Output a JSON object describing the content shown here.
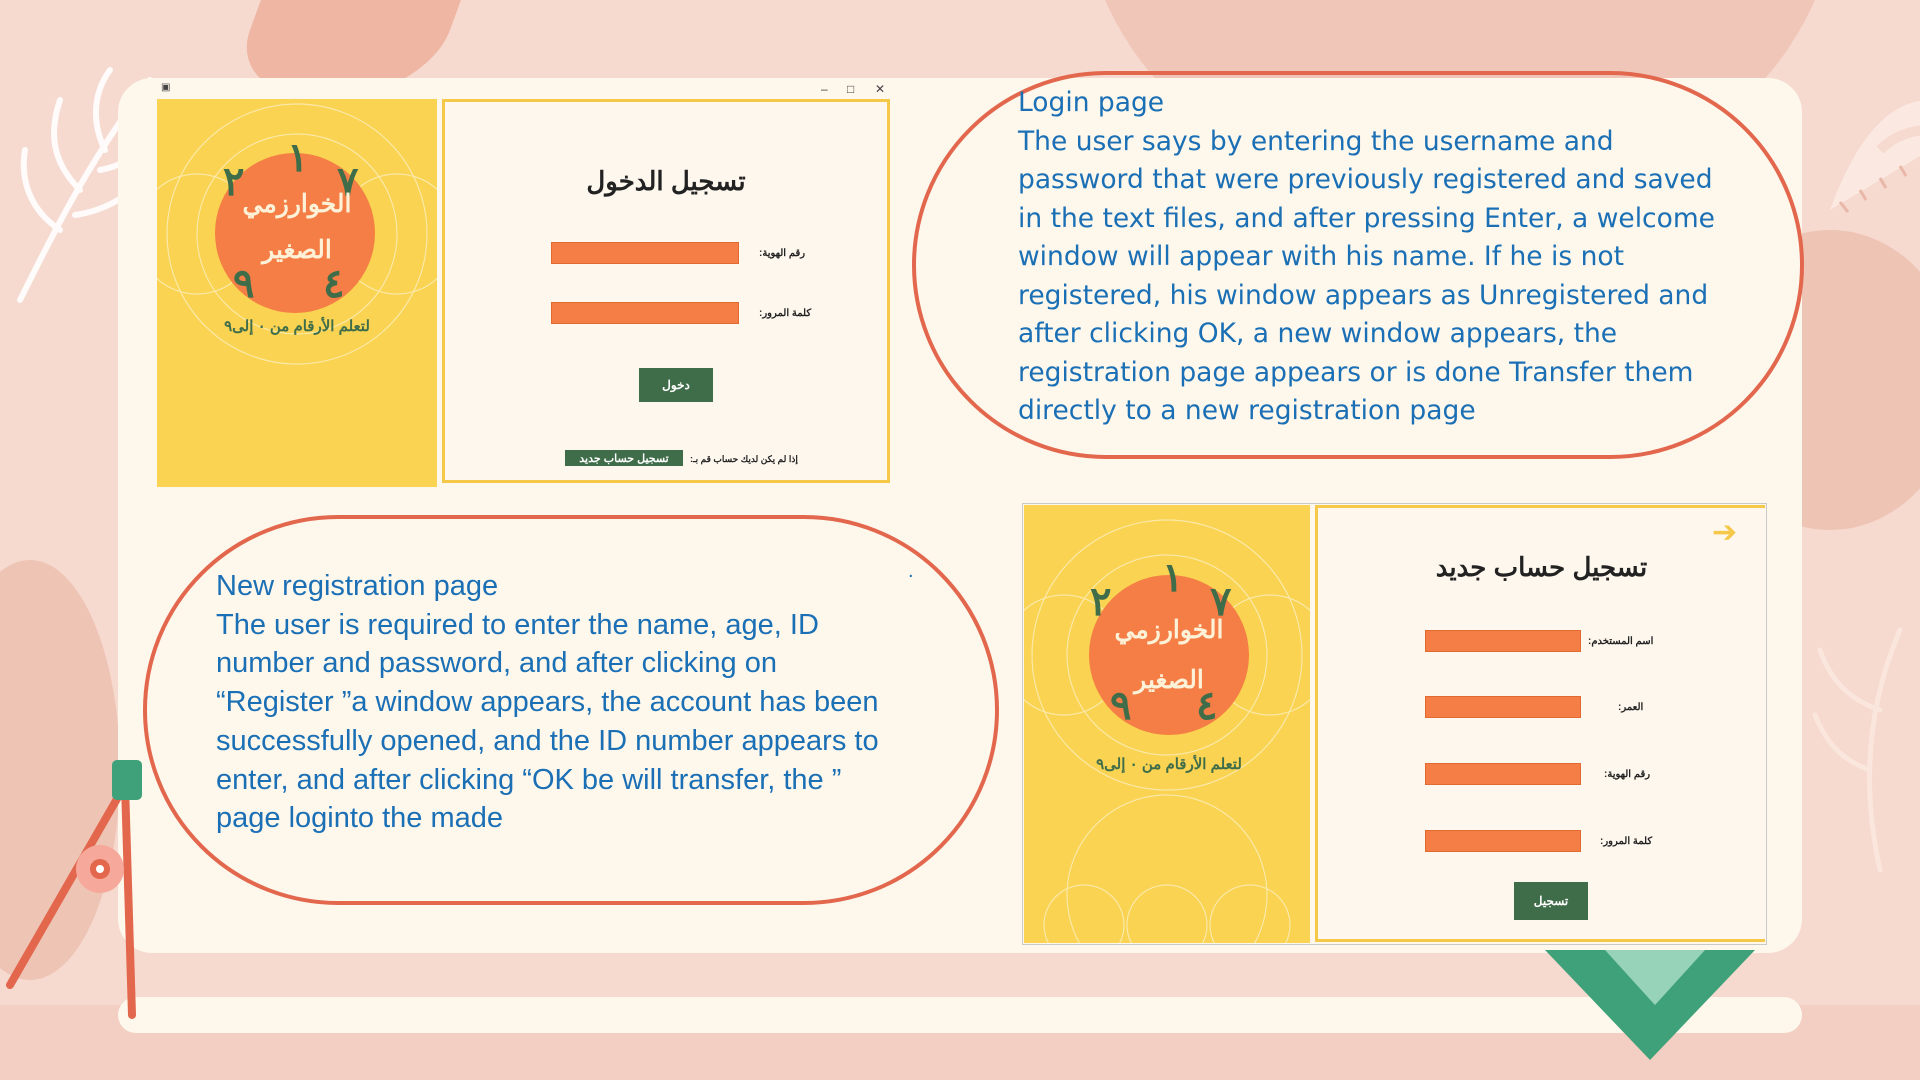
{
  "login_window": {
    "title": "تسجيل الدخول",
    "controls": {
      "minimize": "–",
      "maximize": "□",
      "close": "✕"
    },
    "fields": [
      {
        "label": "رقم الهوية:",
        "value": ""
      },
      {
        "label": "كلمة المرور:",
        "value": ""
      }
    ],
    "login_button": "دخول",
    "no_account_text": "إذا لم يكن لديك حساب قم بـ:",
    "register_link": "تسجيل حساب جديد"
  },
  "logo": {
    "line1": "الخوارزمي",
    "line2": "الصغير",
    "tagline": "لتعلم الأرقام من ٠ إلى٩",
    "digits": [
      "١",
      "٢",
      "٧",
      "٩",
      "٤"
    ],
    "colors": {
      "yellow": "#f9d351",
      "orange": "#f47e45",
      "green": "#3f6d4a"
    }
  },
  "callouts": {
    "login": {
      "lines": [
        "Login page",
        "The user says by entering the username and",
        "password that were previously registered and saved",
        "in the text files, and after pressing Enter, a welcome",
        "window will appear with his name. If he is not",
        "registered, his window appears as Unregistered and",
        "after clicking OK, a new window appears, the",
        "registration page appears or is done Transfer them",
        "directly to a new registration page"
      ]
    },
    "registration": {
      "lines": [
        "New registration page",
        "The user is required to enter the name, age, ID",
        "number and password, and after clicking on",
        "“Register ”a window appears, the account has been",
        "successfully opened, and the ID number appears to",
        "enter, and after clicking “OK be will transfer, the ”",
        "page loginto the  made"
      ],
      "stray_mark": "."
    }
  },
  "register_window": {
    "title": "تسجيل حساب جديد",
    "fields": [
      {
        "label": "اسم المستخدم:",
        "value": ""
      },
      {
        "label": "العمر:",
        "value": ""
      },
      {
        "label": "رقم الهوية:",
        "value": ""
      },
      {
        "label": "كلمة المرور:",
        "value": ""
      }
    ],
    "register_button": "تسجيل"
  },
  "theme": {
    "callout_border": "#e2674d",
    "callout_text": "#1a6fb5",
    "board": "#fdf7ec",
    "background": "#f6d9cf"
  }
}
